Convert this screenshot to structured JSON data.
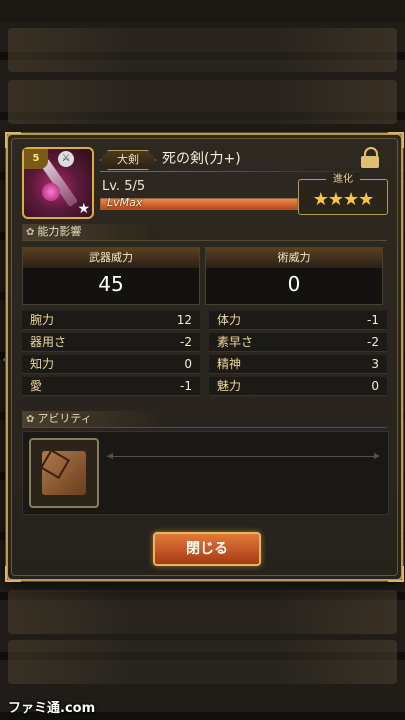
{
  "weapon": {
    "type": "大剣",
    "name": "死の剣(力+)",
    "level": "Lv. 5/5",
    "level_bar_text": "LvMax",
    "level_progress": 1.0,
    "rarity_badge": "5",
    "evolve_label": "進化",
    "evolve_stars": "★★★★"
  },
  "sections": {
    "ability_impact": "能力影響",
    "ability": "アビリティ"
  },
  "power": {
    "weapon_power_label": "武器威力",
    "weapon_power_value": "45",
    "magic_power_label": "術威力",
    "magic_power_value": "0"
  },
  "stats": [
    {
      "label": "腕力",
      "value": "12"
    },
    {
      "label": "体力",
      "value": "-1"
    },
    {
      "label": "器用さ",
      "value": "-2"
    },
    {
      "label": "素早さ",
      "value": "-2"
    },
    {
      "label": "知力",
      "value": "0"
    },
    {
      "label": "精神",
      "value": "3"
    },
    {
      "label": "愛",
      "value": "-1"
    },
    {
      "label": "魅力",
      "value": "0"
    }
  ],
  "close_button": "閉じる",
  "watermark": "ファミ通.com"
}
